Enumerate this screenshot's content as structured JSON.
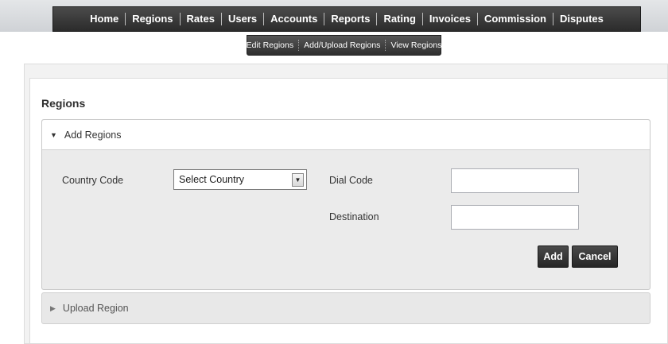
{
  "main_nav": [
    "Home",
    "Regions",
    "Rates",
    "Users",
    "Accounts",
    "Reports",
    "Rating",
    "Invoices",
    "Commission",
    "Disputes"
  ],
  "sub_nav": [
    "Edit Regions",
    "Add/Upload Regions",
    "View Regions"
  ],
  "page": {
    "title": "Regions"
  },
  "add_panel": {
    "header": "Add Regions",
    "country_label": "Country Code",
    "country_value": "Select Country",
    "dial_label": "Dial Code",
    "dial_value": "",
    "destination_label": "Destination",
    "destination_value": "",
    "add_button": "Add",
    "cancel_button": "Cancel"
  },
  "upload_panel": {
    "header": "Upload Region"
  },
  "icons": {
    "expanded": "triangle-down-icon",
    "collapsed": "triangle-right-icon",
    "select": "chevron-down-icon"
  }
}
